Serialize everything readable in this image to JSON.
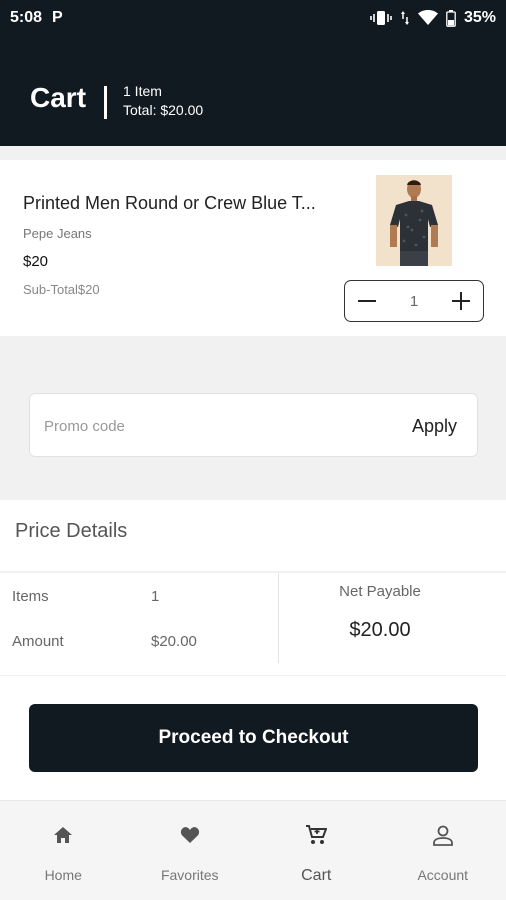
{
  "status_bar": {
    "time": "5:08",
    "app_badge": "P",
    "battery": "35%"
  },
  "header": {
    "title": "Cart",
    "item_count": "1 Item",
    "total": "Total: $20.00"
  },
  "cart_item": {
    "name": "Printed Men Round or Crew Blue T...",
    "brand": "Pepe Jeans",
    "price": "$20",
    "subtotal": "Sub-Total$20",
    "quantity": "1",
    "image_icon": "product-thumbnail-tshirt"
  },
  "promo": {
    "placeholder": "Promo code",
    "apply_label": "Apply"
  },
  "price_details": {
    "title": "Price Details",
    "items_label": "Items",
    "items_value": "1",
    "amount_label": "Amount",
    "amount_value": "$20.00",
    "net_payable_label": "Net Payable",
    "net_payable_value": "$20.00"
  },
  "checkout": {
    "label": "Proceed to Checkout"
  },
  "bottom_nav": {
    "items": [
      {
        "label": "Home",
        "icon": "home-icon"
      },
      {
        "label": "Favorites",
        "icon": "heart-icon"
      },
      {
        "label": "Cart",
        "icon": "cart-icon",
        "active": true
      },
      {
        "label": "Account",
        "icon": "account-icon"
      }
    ]
  },
  "colors": {
    "dark": "#121a21",
    "background": "#f1f1f1",
    "card": "#ffffff"
  }
}
